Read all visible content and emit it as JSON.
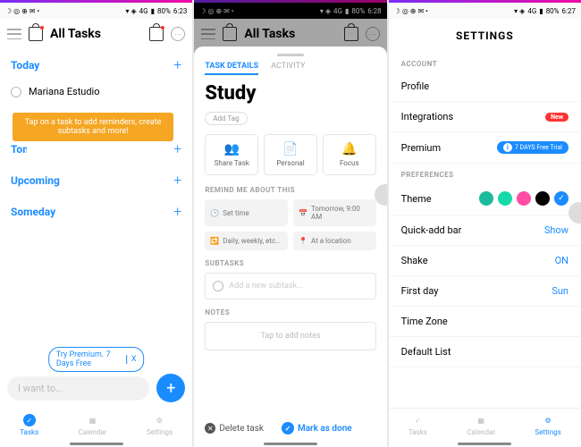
{
  "status": {
    "battery": "80%",
    "time1": "6:23",
    "time2": "6:28",
    "time3": "6:27",
    "signal": "4G"
  },
  "p1": {
    "title": "All Tasks",
    "sections": [
      "Today",
      "Tomorrow",
      "Upcoming",
      "Someday"
    ],
    "task": "Mariana Estudio",
    "tooltip": "Tap on a task to add reminders, create subtasks and more!",
    "premium": "Try Premium. 7 Days Free",
    "premium_x": "X",
    "input_placeholder": "I want to...",
    "nav": [
      "Tasks",
      "Calendar",
      "Settings"
    ]
  },
  "p2": {
    "topTitle": "All Tasks",
    "tabs": [
      "TASK DETAILS",
      "ACTIVITY"
    ],
    "title": "Study",
    "add_tag": "Add Tag",
    "actions": [
      "Share Task",
      "Personal",
      "Focus"
    ],
    "remind_hdr": "REMIND ME ABOUT THIS",
    "chips": [
      "Set time",
      "Tomorrow, 9:00 AM",
      "Daily, weekly, etc..",
      "At a location"
    ],
    "subtasks_hdr": "SUBTASKS",
    "subtask_placeholder": "Add a new subtask...",
    "notes_hdr": "NOTES",
    "notes_placeholder": "Tap to add notes",
    "delete": "Delete task",
    "done": "Mark as done"
  },
  "p3": {
    "title": "SETTINGS",
    "account_hdr": "ACCOUNT",
    "account": [
      "Profile",
      "Integrations",
      "Premium"
    ],
    "new": "New",
    "trial": "7 DAYS Free Trial",
    "trial_i": "i",
    "prefs_hdr": "PREFERENCES",
    "theme_label": "Theme",
    "theme_colors": [
      "#1abc9c",
      "#16d9a8",
      "#ff4da6",
      "#000000",
      "#1a8cff"
    ],
    "rows": [
      {
        "label": "Quick-add bar",
        "val": "Show"
      },
      {
        "label": "Shake",
        "val": "ON"
      },
      {
        "label": "First day",
        "val": "Sun"
      },
      {
        "label": "Time Zone",
        "val": ""
      },
      {
        "label": "Default List",
        "val": ""
      }
    ],
    "nav": [
      "Tasks",
      "Calendar",
      "Settings"
    ]
  }
}
